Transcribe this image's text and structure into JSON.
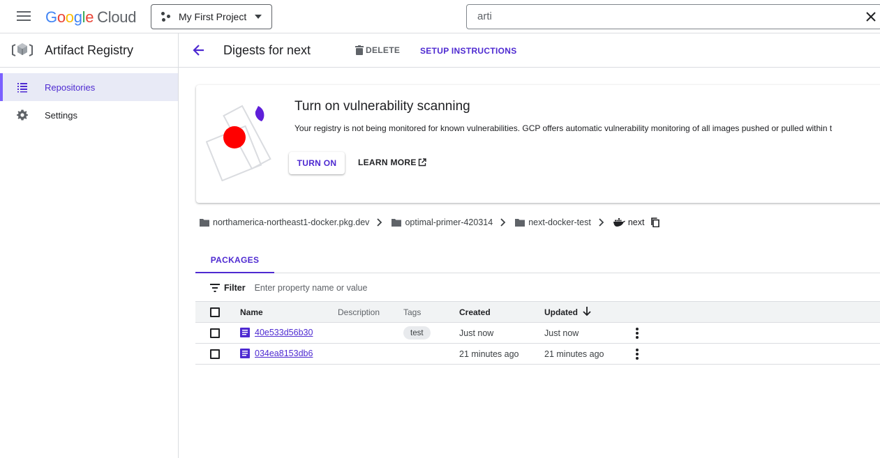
{
  "header": {
    "logo_google": "Google",
    "logo_cloud": "Cloud",
    "project": "My First Project",
    "search_value": "arti"
  },
  "sidebar": {
    "title": "Artifact Registry",
    "items": [
      {
        "label": "Repositories",
        "icon": "list-icon",
        "active": true
      },
      {
        "label": "Settings",
        "icon": "gear-icon",
        "active": false
      }
    ]
  },
  "page": {
    "title": "Digests for next",
    "delete_label": "DELETE",
    "setup_label": "SETUP INSTRUCTIONS"
  },
  "banner": {
    "title": "Turn on vulnerability scanning",
    "description": "Your registry is not being monitored for known vulnerabilities. GCP offers automatic vulnerability monitoring of all images pushed or pulled within t",
    "turn_on_label": "TURN ON",
    "learn_more_label": "LEARN MORE"
  },
  "breadcrumb": {
    "items": [
      "northamerica-northeast1-docker.pkg.dev",
      "optimal-primer-420314",
      "next-docker-test",
      "next"
    ]
  },
  "tabs": [
    {
      "label": "PACKAGES"
    }
  ],
  "filter": {
    "label": "Filter",
    "placeholder": "Enter property name or value"
  },
  "table": {
    "columns": [
      "Name",
      "Description",
      "Tags",
      "Created",
      "Updated"
    ],
    "sort_column": "Updated",
    "rows": [
      {
        "name": "40e533d56b30",
        "description": "",
        "tags": "test",
        "created": "Just now",
        "updated": "Just now"
      },
      {
        "name": "034ea8153db6",
        "description": "",
        "tags": "",
        "created": "21 minutes ago",
        "updated": "21 minutes ago"
      }
    ]
  },
  "colors": {
    "accent": "#4e2ad1",
    "active_bg": "#e8eaf6",
    "border": "#dadce0"
  }
}
